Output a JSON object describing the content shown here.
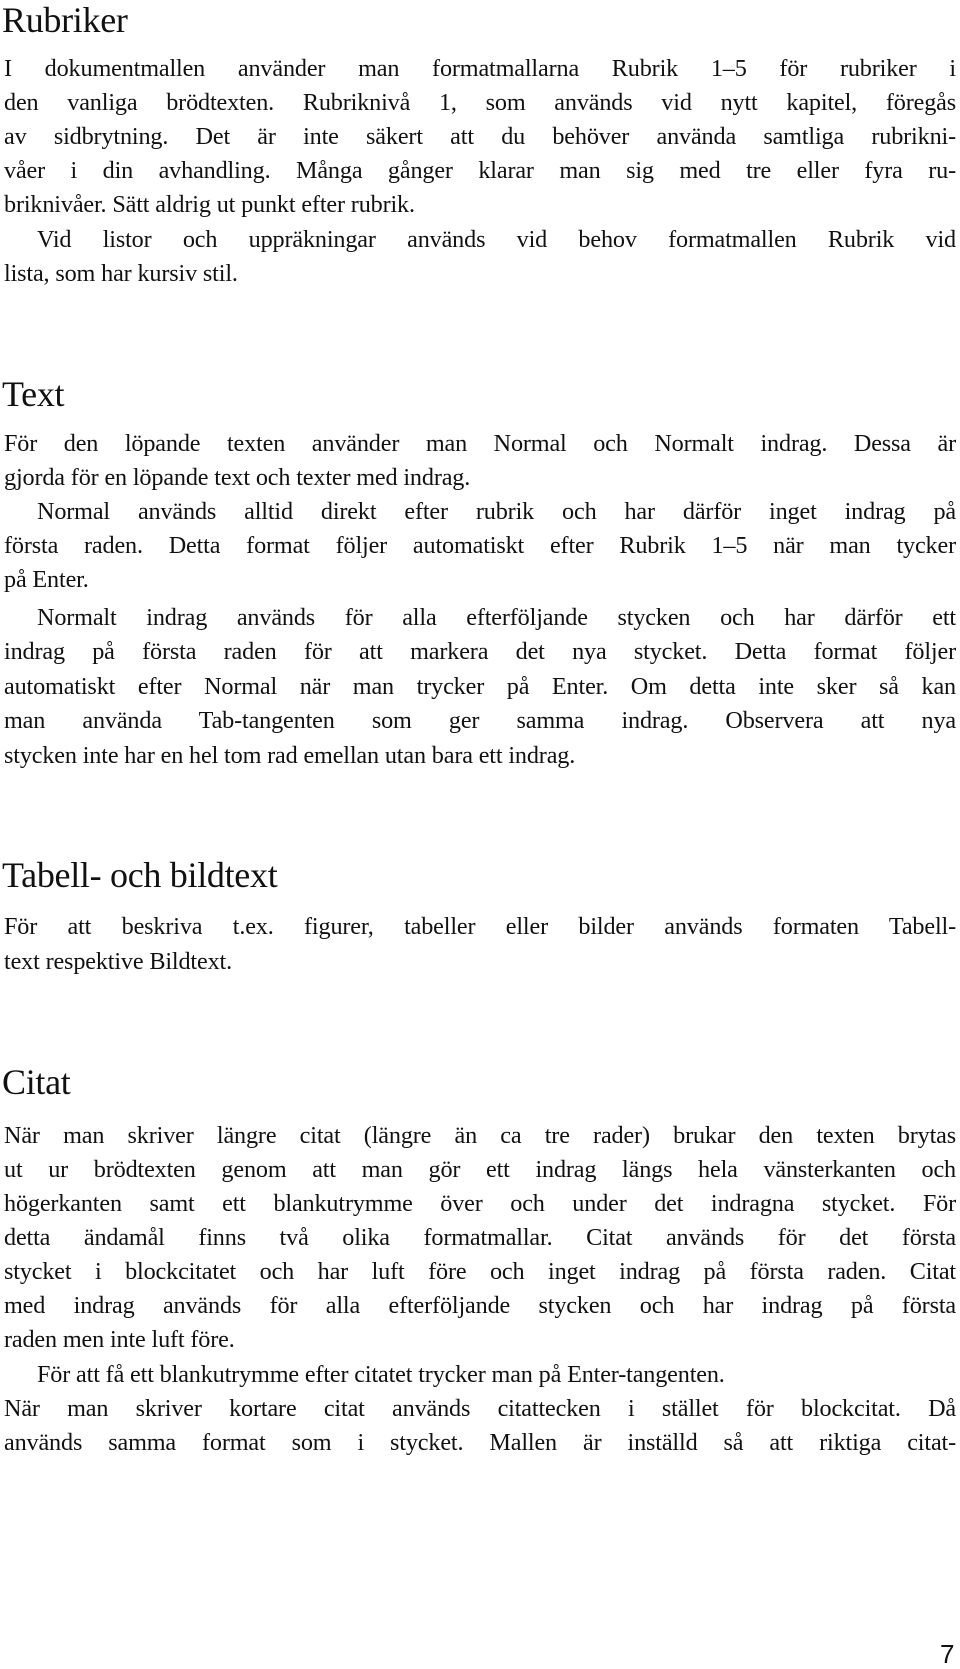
{
  "sections": [
    {
      "heading": "Rubriker",
      "lines": [
        "I dokumentmallen använder man formatmallarna Rubrik 1–5 för rubriker i",
        "den vanliga brödtexten. Rubriknivå 1, som används vid nytt kapitel, föregås",
        "av sidbrytning. Det är inte säkert att du behöver använda samtliga rubrikni-",
        "våer i din avhandling. Många gånger klarar man sig med tre eller fyra ru-",
        "briknivåer. Sätt aldrig ut punkt efter rubrik.",
        "Vid listor och uppräkningar används vid behov formatmallen Rubrik vid",
        "lista, som har kursiv stil."
      ]
    },
    {
      "heading": "Text",
      "lines": [
        "För den löpande texten använder man Normal och Normalt indrag. Dessa är",
        "gjorda för en löpande text och texter med indrag.",
        "Normal används alltid direkt efter rubrik och har därför inget indrag på",
        "första raden. Detta format följer automatiskt efter Rubrik 1–5 när man tycker",
        "på Enter.",
        "Normalt indrag används för alla efterföljande stycken och har därför ett",
        "indrag på första raden för att markera det nya stycket. Detta format följer",
        "automatiskt efter Normal när man trycker på Enter. Om detta inte sker så kan",
        "man använda Tab-tangenten som ger samma indrag. Observera att nya",
        "stycken inte har en hel tom rad emellan utan bara ett indrag."
      ]
    },
    {
      "heading": "Tabell- och bildtext",
      "lines": [
        "För att beskriva t.ex. figurer, tabeller eller bilder används formaten Tabell-",
        "text respektive Bildtext."
      ]
    },
    {
      "heading": "Citat",
      "lines": [
        "När man skriver längre citat (längre än ca tre rader) brukar den texten brytas",
        "ut ur brödtexten genom att man gör ett indrag längs hela vänsterkanten och",
        "högerkanten samt ett blankutrymme över och under det indragna stycket. För",
        "detta ändamål finns två olika formatmallar. Citat används för det första",
        "stycket i blockcitatet och har luft före och inget indrag på första raden. Citat",
        "med indrag används för alla efterföljande stycken och har indrag på första",
        "raden men inte luft före.",
        "För att få ett blankutrymme efter citatet trycker man på Enter-tangenten.",
        "När man skriver kortare citat används citattecken i stället för blockcitat. Då",
        "används samma format som i stycket. Mallen är inställd så att riktiga citat-"
      ]
    }
  ],
  "page_number": "7"
}
